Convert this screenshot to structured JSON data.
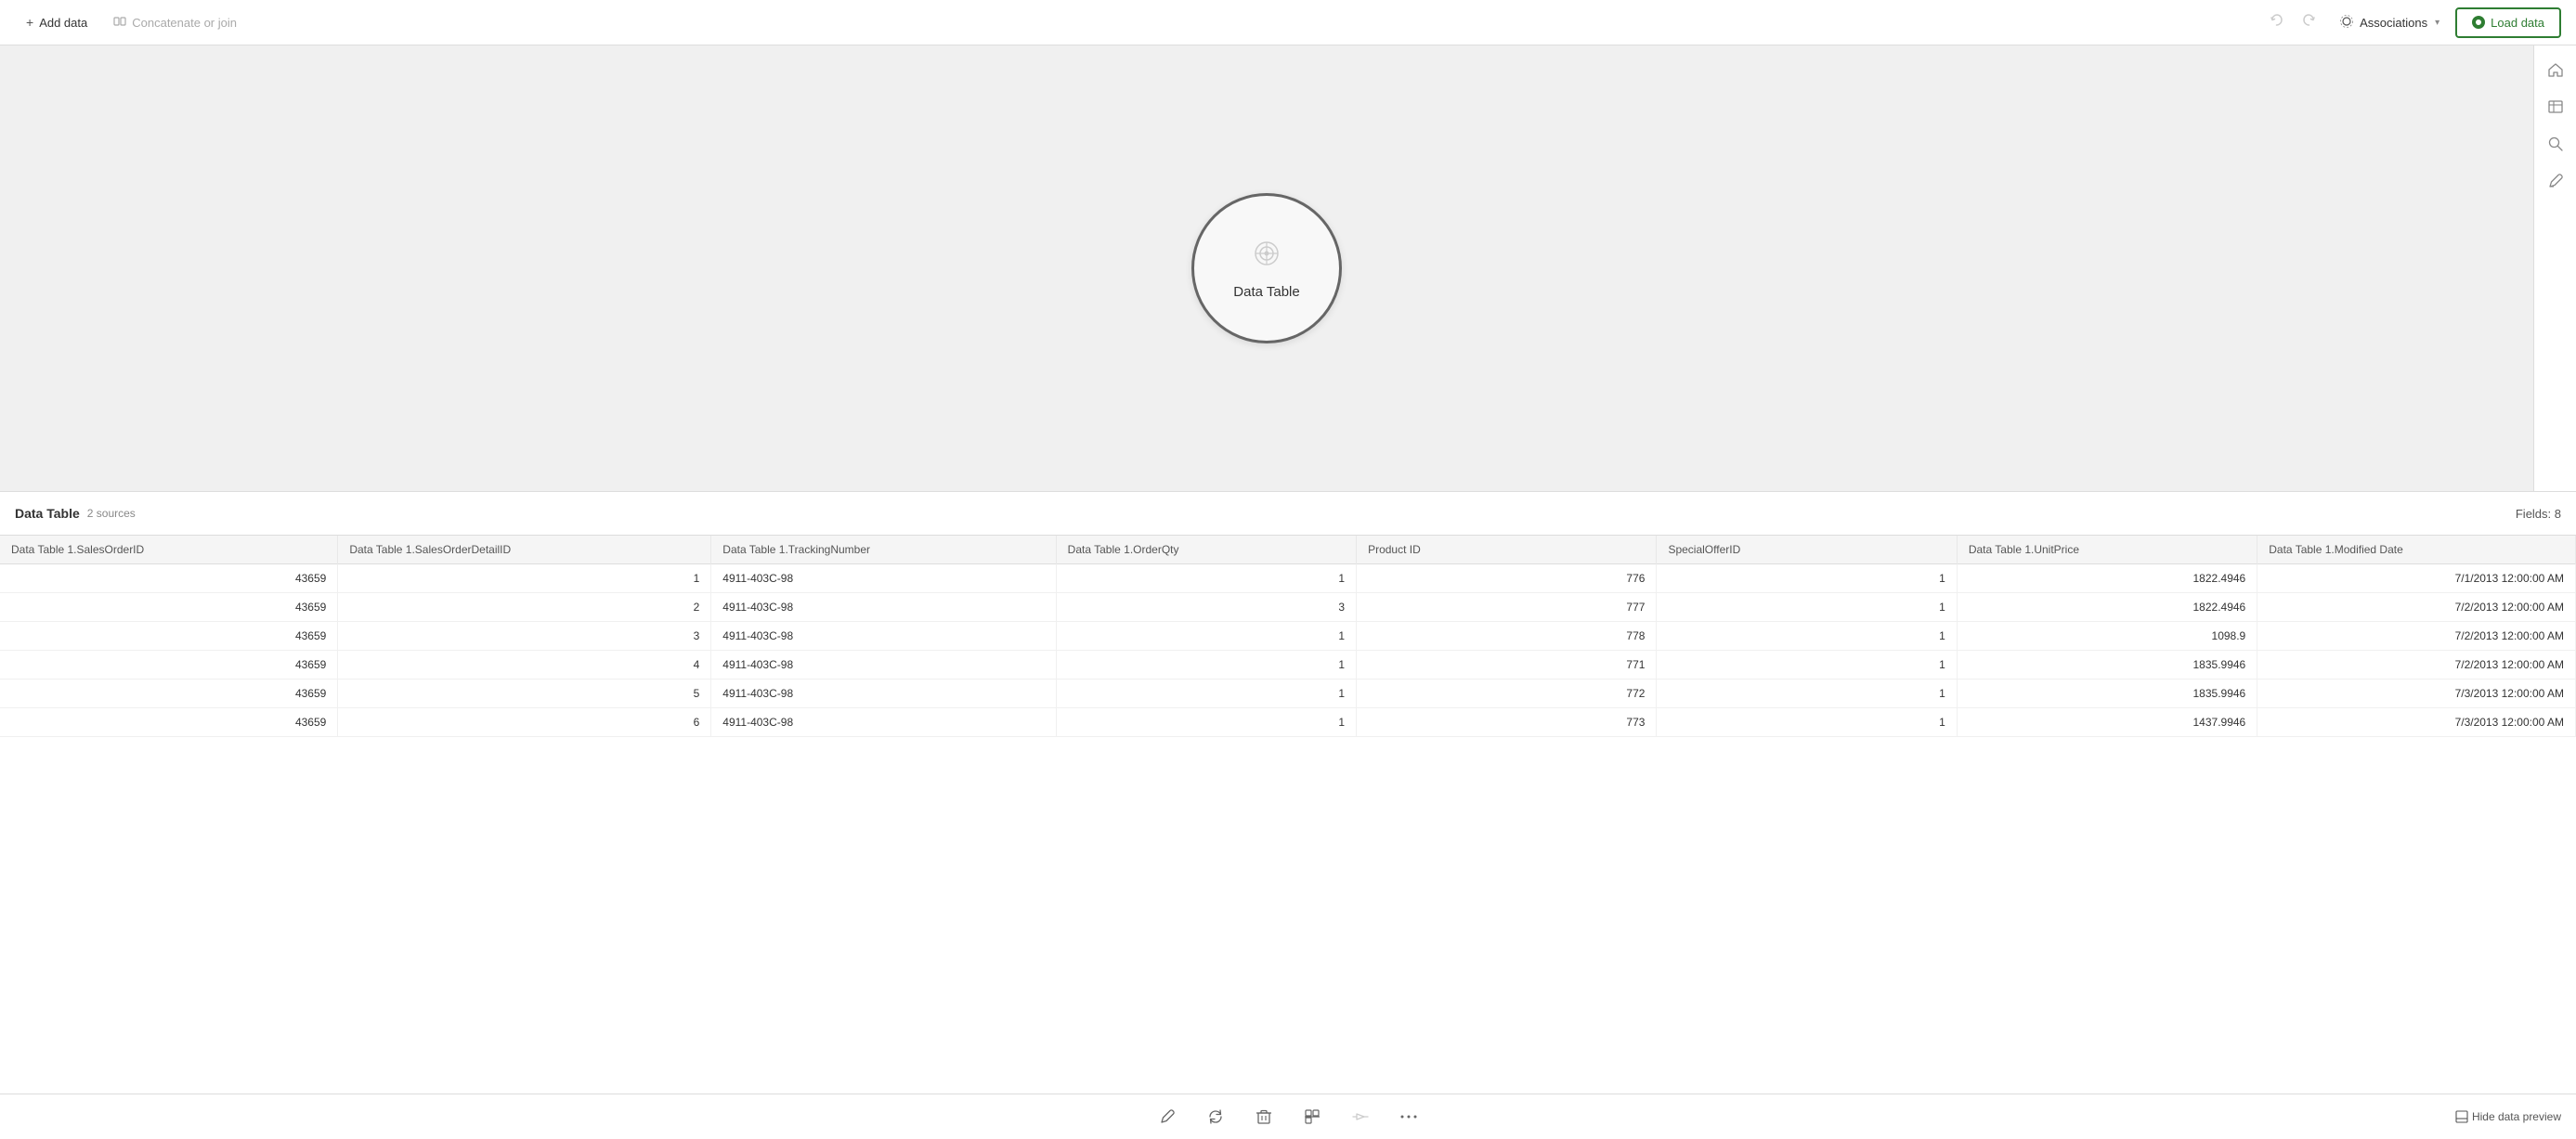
{
  "toolbar": {
    "add_data_label": "Add data",
    "concatenate_label": "Concatenate or join",
    "associations_label": "Associations",
    "load_data_label": "Load data"
  },
  "canvas": {
    "node_label": "Data Table",
    "node_icon": "⊚"
  },
  "bottom_bar": {
    "title": "Data Table",
    "sources": "2 sources",
    "fields": "Fields: 8"
  },
  "table": {
    "columns": [
      "Data Table 1.SalesOrderID",
      "Data Table 1.SalesOrderDetailID",
      "Data Table 1.TrackingNumber",
      "Data Table 1.OrderQty",
      "Product ID",
      "SpecialOfferID",
      "Data Table 1.UnitPrice",
      "Data Table 1.Modified Date"
    ],
    "rows": [
      [
        "43659",
        "1",
        "4911-403C-98",
        "1",
        "776",
        "1",
        "1822.4946",
        "7/1/2013 12:00:00 AM"
      ],
      [
        "43659",
        "2",
        "4911-403C-98",
        "3",
        "777",
        "1",
        "1822.4946",
        "7/2/2013 12:00:00 AM"
      ],
      [
        "43659",
        "3",
        "4911-403C-98",
        "1",
        "778",
        "1",
        "1098.9",
        "7/2/2013 12:00:00 AM"
      ],
      [
        "43659",
        "4",
        "4911-403C-98",
        "1",
        "771",
        "1",
        "1835.9946",
        "7/2/2013 12:00:00 AM"
      ],
      [
        "43659",
        "5",
        "4911-403C-98",
        "1",
        "772",
        "1",
        "1835.9946",
        "7/3/2013 12:00:00 AM"
      ],
      [
        "43659",
        "6",
        "4911-403C-98",
        "1",
        "773",
        "1",
        "1437.9946",
        "7/3/2013 12:00:00 AM"
      ]
    ]
  },
  "bottom_tools": {
    "edit_label": "✎",
    "refresh_label": "↻",
    "delete_label": "🗑",
    "split_label": "⇔",
    "merge_label": "⇦",
    "more_label": "•••",
    "hide_preview_label": "Hide data preview"
  },
  "sidebar_icons": {
    "home": "⌂",
    "table": "▦",
    "search": "⌕",
    "pen": "✎"
  }
}
